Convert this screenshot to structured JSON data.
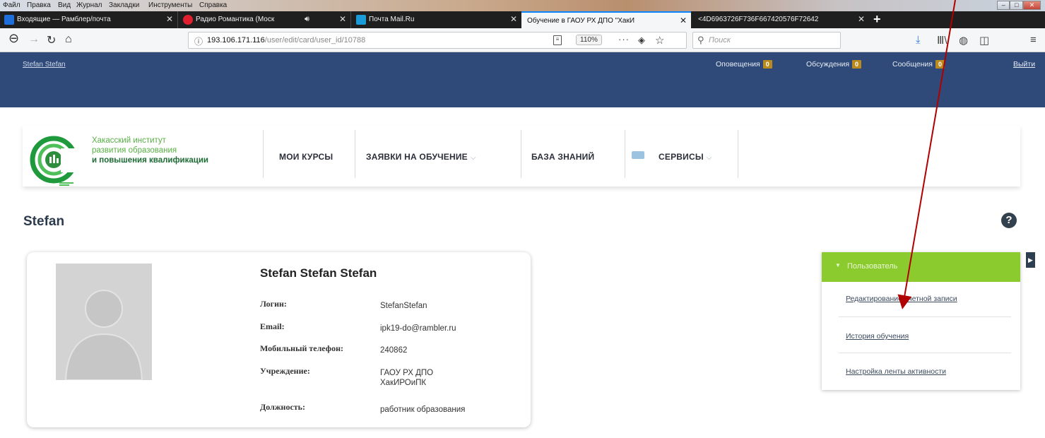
{
  "menubar": [
    "Файл",
    "Правка",
    "Вид",
    "Журнал",
    "Закладки",
    "Инструменты",
    "Справка"
  ],
  "tabs": [
    {
      "title": "Входящие — Рамблер/почта",
      "icon": "mail-icon",
      "color": "#1e6fd9"
    },
    {
      "title": "Радио Романтика (Моск",
      "icon": "radio-icon",
      "color": "#e0202e"
    },
    {
      "title": "Почта Mail.Ru",
      "icon": "mailru-icon",
      "color": "#1a9bd7"
    },
    {
      "title": "Обучение в ГАОУ РХ ДПО \"ХакИ",
      "icon": "page-icon",
      "color": "#ffffff"
    },
    {
      "title": "<4D6963726F736F667420576F72642",
      "icon": "page-icon",
      "color": "#ffffff"
    }
  ],
  "nav": {
    "url_host": "193.106.171.116",
    "url_path": "/user/edit/card/user_id/10788",
    "zoom": "110%",
    "search_placeholder": "Поиск"
  },
  "topbar": {
    "username": "Stefan Stefan",
    "notifications_label": "Оповещения",
    "notifications_count": "0",
    "discussions_label": "Обсуждения",
    "discussions_count": "0",
    "messages_label": "Сообщения",
    "messages_count": "0",
    "logout": "Выйти"
  },
  "header": {
    "logo_line1": "Хакасский институт",
    "logo_line2": "развития образования",
    "logo_line3": "и повышения квалификации",
    "nav_courses": "МОИ КУРСЫ",
    "nav_applications": "ЗАЯВКИ НА ОБУЧЕНИЕ",
    "nav_knowledge": "БАЗА ЗНАНИЙ",
    "nav_services": "СЕРВИСЫ"
  },
  "page": {
    "title": "Stefan"
  },
  "profile": {
    "fullname": "Stefan Stefan Stefan",
    "login_label": "Логин:",
    "login_value": "StefanStefan",
    "email_label": "Email:",
    "email_value": "ipk19-do@rambler.ru",
    "phone_label": "Мобильный телефон:",
    "phone_value": "240862",
    "org_label": "Учреждение:",
    "org_value_line1": "ГАОУ РХ ДПО",
    "org_value_line2": "ХакИРОиПК",
    "position_label": "Должность:",
    "position_value": "работник образования"
  },
  "sidebar": {
    "header": "Пользователь",
    "link_edit": "Редактирование учетной записи",
    "link_history": "История обучения",
    "link_feed": "Настройка ленты активности"
  },
  "colors": {
    "topbar": "#2f4a78",
    "sidebar_header": "#8ccb2e",
    "badge": "#b98b1e",
    "annotation_arrow": "#b00000"
  }
}
